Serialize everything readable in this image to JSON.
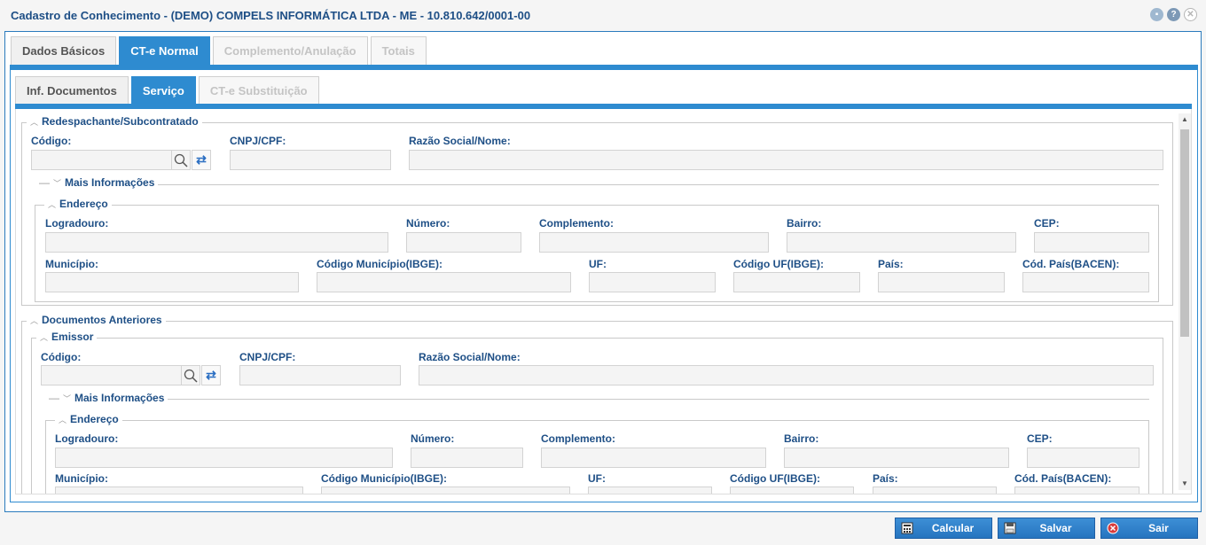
{
  "window": {
    "title": "Cadastro de Conhecimento - (DEMO) COMPELS INFORMÁTICA LTDA - ME - 10.810.642/0001-00"
  },
  "main_tabs": [
    {
      "label": "Dados Básicos"
    },
    {
      "label": "CT-e Normal"
    },
    {
      "label": "Complemento/Anulação"
    },
    {
      "label": "Totais"
    }
  ],
  "sub_tabs": [
    {
      "label": "Inf. Documentos"
    },
    {
      "label": "Serviço"
    },
    {
      "label": "CT-e Substituição"
    }
  ],
  "redespachante": {
    "legend": "Redespachante/Subcontratado",
    "codigo_label": "Código:",
    "cnpj_label": "CNPJ/CPF:",
    "razao_label": "Razão Social/Nome:",
    "mais_info": "Mais Informações",
    "endereco": {
      "legend": "Endereço",
      "logradouro": "Logradouro:",
      "numero": "Número:",
      "complemento": "Complemento:",
      "bairro": "Bairro:",
      "cep": "CEP:",
      "municipio": "Município:",
      "cod_municipio": "Código Município(IBGE):",
      "uf": "UF:",
      "cod_uf": "Código UF(IBGE):",
      "pais": "País:",
      "cod_pais": "Cód. País(BACEN):"
    }
  },
  "documentos_anteriores": {
    "legend": "Documentos Anteriores",
    "emissor": {
      "legend": "Emissor",
      "codigo_label": "Código:",
      "cnpj_label": "CNPJ/CPF:",
      "razao_label": "Razão Social/Nome:",
      "mais_info": "Mais Informações",
      "endereco": {
        "legend": "Endereço",
        "logradouro": "Logradouro:",
        "numero": "Número:",
        "complemento": "Complemento:",
        "bairro": "Bairro:",
        "cep": "CEP:",
        "municipio": "Município:",
        "cod_municipio": "Código Município(IBGE):",
        "uf": "UF:",
        "cod_uf": "Código UF(IBGE):",
        "pais": "País:",
        "cod_pais": "Cód. País(BACEN):"
      }
    }
  },
  "footer": {
    "calcular": "Calcular",
    "salvar": "Salvar",
    "sair": "Sair"
  },
  "colors": {
    "accent": "#2e8bd0",
    "label": "#1e4f86",
    "button": "#2674bf"
  }
}
